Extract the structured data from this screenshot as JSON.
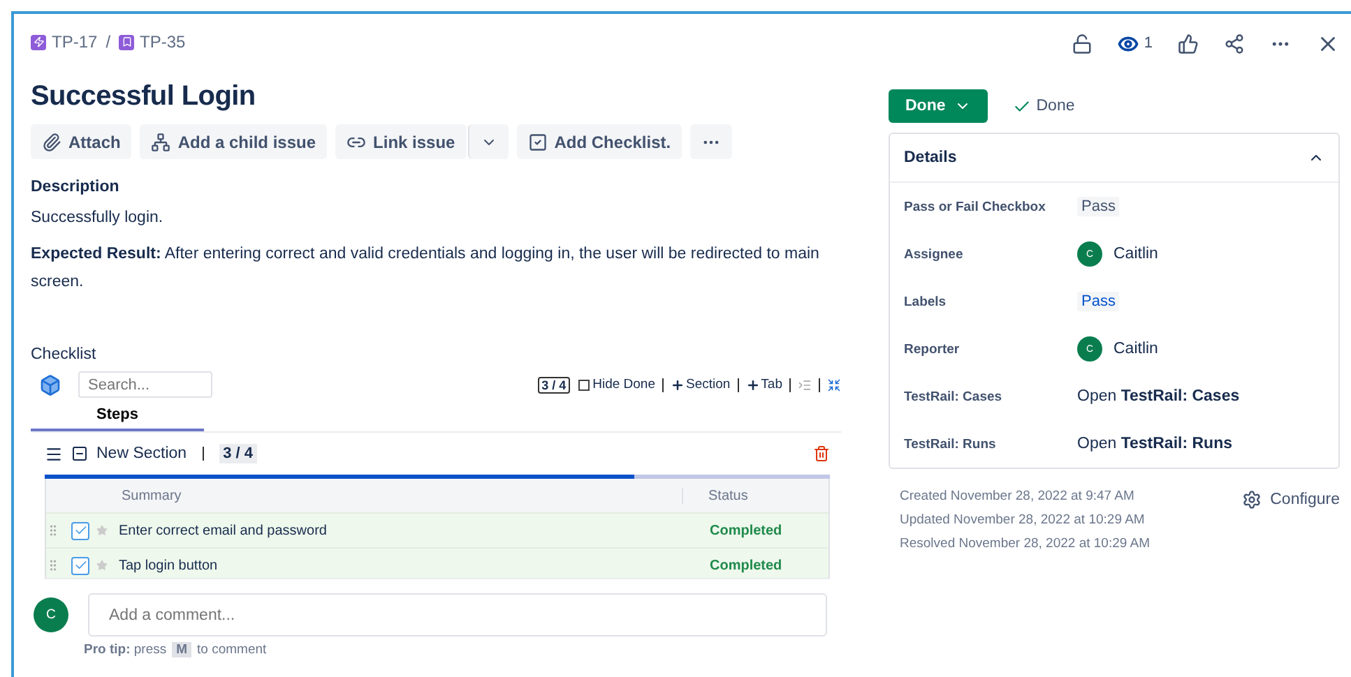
{
  "breadcrumbs": [
    {
      "key": "TP-17",
      "kind": "epic"
    },
    {
      "key": "TP-35",
      "kind": "story"
    }
  ],
  "breadcrumb_separator": "/",
  "watchers": "1",
  "title": "Successful Login",
  "actions": [
    {
      "label": "Attach",
      "kind": "attach"
    },
    {
      "label": "Add a child issue",
      "kind": "child"
    },
    {
      "label": "Link issue",
      "kind": "link"
    },
    {
      "kind": "dropdown"
    },
    {
      "label": "Add Checklist.",
      "kind": "checklist"
    },
    {
      "kind": "more"
    }
  ],
  "description": {
    "heading": "Description",
    "paragraphs": [
      "Successfully login.",
      "**Expected Result:** After entering correct and valid credentials and logging in, the user will be redirected to main screen."
    ]
  },
  "checklist": {
    "heading": "Checklist",
    "search_placeholder": "Search...",
    "count": "3 / 4",
    "hide_done": {
      "label": "Hide Done",
      "checked": false
    },
    "add_section": "Section",
    "add_tab": "Tab",
    "tabs": [
      {
        "label": "Steps",
        "selected": true
      }
    ],
    "section": {
      "title": "New Section",
      "count": "3 / 4",
      "level": 0.75,
      "columns": [
        "Summary",
        "Status"
      ],
      "rows": [
        {
          "summary": "Enter correct email and password",
          "status": "Completed",
          "checked": true
        },
        {
          "summary": "Tap login button",
          "status": "Completed",
          "checked": true
        }
      ]
    }
  },
  "comment": {
    "avatar": "C",
    "placeholder": "Add a comment...",
    "tip": "**Pro tip:** press",
    "key": "M",
    "tip_end": "to comment"
  },
  "status": {
    "button": "Done",
    "resolution": "Done"
  },
  "details": {
    "heading": "Details",
    "expanded": true,
    "fields": [
      {
        "label": "Pass or Fail Checkbox",
        "kind": "tag",
        "value": "Pass"
      },
      {
        "label": "Assignee",
        "kind": "user",
        "value": "Caitlin",
        "avatar": "C"
      },
      {
        "label": "Labels",
        "kind": "label",
        "value": "Pass"
      },
      {
        "label": "Reporter",
        "kind": "user",
        "value": "Caitlin",
        "avatar": "C"
      },
      {
        "label": "TestRail: Cases",
        "kind": "link",
        "value": "Open **TestRail: Cases**"
      },
      {
        "label": "TestRail: Runs",
        "kind": "link",
        "value": "Open **TestRail: Runs**"
      }
    ]
  },
  "dates": [
    "Created November 28, 2022 at 9:47 AM",
    "Updated November 28, 2022 at 10:29 AM",
    "Resolved November 28, 2022 at 10:29 AM"
  ],
  "configure": "Configure"
}
